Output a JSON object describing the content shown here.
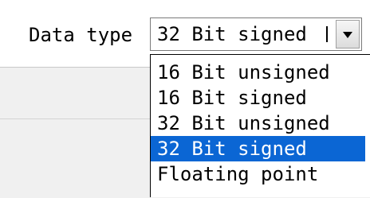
{
  "field": {
    "label": "Data type",
    "selected_value": "32 Bit signed"
  },
  "dropdown": {
    "items": [
      {
        "label": "16 Bit unsigned"
      },
      {
        "label": "16 Bit signed"
      },
      {
        "label": "32 Bit unsigned"
      },
      {
        "label": "32 Bit signed",
        "selected": true
      },
      {
        "label": "Floating point"
      }
    ]
  },
  "colors": {
    "selection_background": "#0b66d4",
    "selection_text": "#ffffff"
  },
  "icons": {
    "combo_button": "chevron-down-icon"
  }
}
